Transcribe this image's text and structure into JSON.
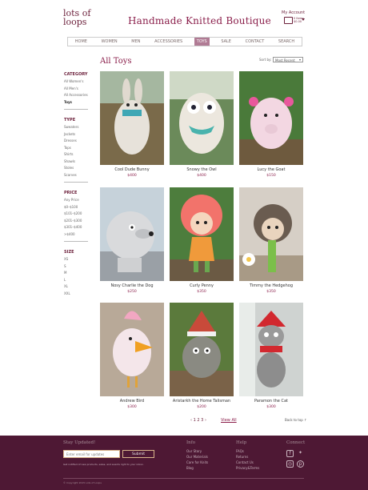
{
  "header": {
    "logo_line1": "lots of",
    "logo_line2": "loops",
    "brand": "Handmade Knitted Boutique",
    "my_account": "My Account",
    "cart_qty": "0 Items",
    "cart_total": "$0.00"
  },
  "nav": [
    "HOME",
    "WOMEN",
    "MEN",
    "ACCESSORIES",
    "TOYS",
    "SALE",
    "CONTACT",
    "SEARCH"
  ],
  "page_title": "All Toys",
  "sort": {
    "label": "Sort by:",
    "value": "Most Recent"
  },
  "sidebar": {
    "category": {
      "title": "CATEGORY",
      "items": [
        "All Women's",
        "All Men's",
        "All Accessories",
        "Toys"
      ]
    },
    "type": {
      "title": "TYPE",
      "items": [
        "Sweaters",
        "Jackets",
        "Dresses",
        "Tops",
        "Shirts",
        "Shawls",
        "Stoles",
        "Scarves"
      ]
    },
    "price": {
      "title": "PRICE",
      "items": [
        "Any Price",
        "$0–$100",
        "$101–$200",
        "$201–$300",
        "$301–$400",
        ">$400"
      ]
    },
    "size": {
      "title": "SIZE",
      "items": [
        "XS",
        "S",
        "M",
        "L",
        "XL",
        "XXL"
      ]
    }
  },
  "products": [
    {
      "name": "Cool Dude Bunny",
      "price": "$400"
    },
    {
      "name": "Snowy the Owl",
      "price": "$400"
    },
    {
      "name": "Lucy the Goat",
      "price": "$150"
    },
    {
      "name": "Nosy Charlie the Dog",
      "price": "$250"
    },
    {
      "name": "Curly Penny",
      "price": "$350"
    },
    {
      "name": "Timmy the Hedgehog",
      "price": "$350"
    },
    {
      "name": "Andrew Bird",
      "price": "$300"
    },
    {
      "name": "Aristarkh the Home Talisman",
      "price": "$200"
    },
    {
      "name": "Paramon the Cat",
      "price": "$300"
    }
  ],
  "pagination": {
    "prev": "‹",
    "pages": [
      "1",
      "2",
      "3"
    ],
    "next": "›",
    "view_all": "View All"
  },
  "back_to_top": "Back to top",
  "footer": {
    "stay_updated": "Stay Updated!",
    "email_placeholder": "Enter email for updates",
    "submit": "Submit",
    "note": "Get notified of new products, sales, and events right to your inbox.",
    "info": {
      "title": "Info",
      "items": [
        "Our Story",
        "Our Materials",
        "Care for Knits",
        "Blog"
      ]
    },
    "help": {
      "title": "Help",
      "items": [
        "FAQs",
        "Returns",
        "Contact Us",
        "Privacy&Terms"
      ]
    },
    "connect": {
      "title": "Connect"
    },
    "copyright": "© Copyright 2015 Lots of Loops"
  },
  "colors": {
    "brand": "#8a1e4a",
    "footer_bg": "#4e1834",
    "nav_active": "#b07b94",
    "accent_gold": "#d9b58b"
  }
}
